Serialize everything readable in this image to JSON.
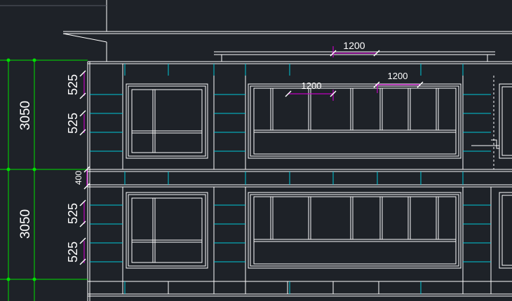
{
  "drawing": {
    "background": "#1e2228",
    "colors": {
      "building_line": "#ffffff",
      "tile_line": "#00c8d8",
      "dim_vertical": "#00e000",
      "dim_tick": "#c000c0",
      "dim_text": "#ffffff"
    },
    "left_dimensions": {
      "floor_height_upper": "3050",
      "floor_height_lower": "3050",
      "slab_band": "400",
      "tile_course_1": "525",
      "tile_course_2": "525",
      "tile_course_3": "525",
      "tile_course_4": "525"
    },
    "horizontal_dimensions": {
      "top_span": "1200",
      "window_span_left": "1200",
      "window_span_right": "1200"
    }
  }
}
